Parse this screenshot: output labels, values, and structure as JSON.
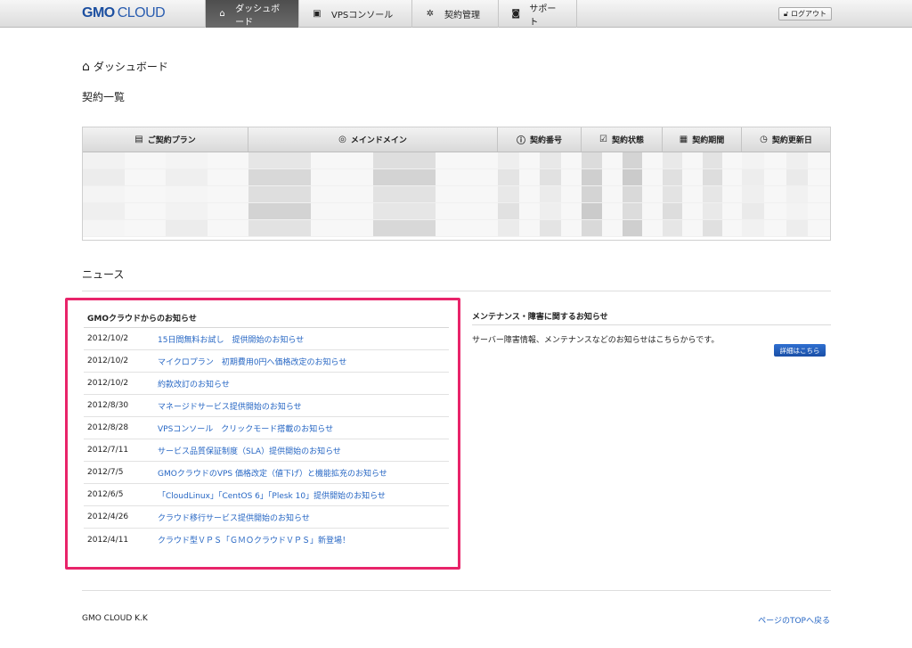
{
  "header": {
    "logo_brand": "GMO",
    "logo_product": "CLOUD",
    "nav": [
      {
        "label": "ダッシュボード",
        "icon": "home-icon"
      },
      {
        "label": "VPSコンソール",
        "icon": "console-icon"
      },
      {
        "label": "契約管理",
        "icon": "gear-icon"
      },
      {
        "label": "サポート",
        "icon": "camera-icon"
      }
    ],
    "logout_label": "ログアウト"
  },
  "page_title": "ダッシュボード",
  "contracts": {
    "title": "契約一覧",
    "columns": [
      {
        "label": "ご契約プラン",
        "icon": "document-icon"
      },
      {
        "label": "メインドメイン",
        "icon": "globe-icon"
      },
      {
        "label": "契約番号",
        "icon": "info-icon"
      },
      {
        "label": "契約状態",
        "icon": "checkbox-icon"
      },
      {
        "label": "契約期間",
        "icon": "calendar-icon"
      },
      {
        "label": "契約更新日",
        "icon": "clock-icon"
      }
    ]
  },
  "news": {
    "title": "ニュース",
    "gmo_title": "GMOクラウドからのお知らせ",
    "items": [
      {
        "date": "2012/10/2",
        "text": "15日間無料お試し　提供開始のお知らせ"
      },
      {
        "date": "2012/10/2",
        "text": "マイクロプラン　初期費用0円へ価格改定のお知らせ"
      },
      {
        "date": "2012/10/2",
        "text": "約款改訂のお知らせ"
      },
      {
        "date": "2012/8/30",
        "text": "マネージドサービス提供開始のお知らせ"
      },
      {
        "date": "2012/8/28",
        "text": "VPSコンソール　クリックモード搭載のお知らせ"
      },
      {
        "date": "2012/7/11",
        "text": "サービス品質保証制度（SLA）提供開始のお知らせ"
      },
      {
        "date": "2012/7/5",
        "text": "GMOクラウドのVPS 価格改定（値下げ）と機能拡充のお知らせ"
      },
      {
        "date": "2012/6/5",
        "text": "「CloudLinux」「CentOS 6」「Plesk 10」提供開始のお知らせ"
      },
      {
        "date": "2012/4/26",
        "text": "クラウド移行サービス提供開始のお知らせ"
      },
      {
        "date": "2012/4/11",
        "text": "クラウド型ＶＰＳ「ＧＭＯクラウドＶＰＳ」新登場！"
      }
    ],
    "maintenance_title": "メンテナンス・障害に関するお知らせ",
    "maintenance_text": "サーバー障害情報、メンテナンスなどのお知らせはこちらからです。",
    "detail_button": "詳細はこちら"
  },
  "footer": {
    "company": "GMO CLOUD K.K",
    "top_link": "ページのTOPへ戻る"
  }
}
